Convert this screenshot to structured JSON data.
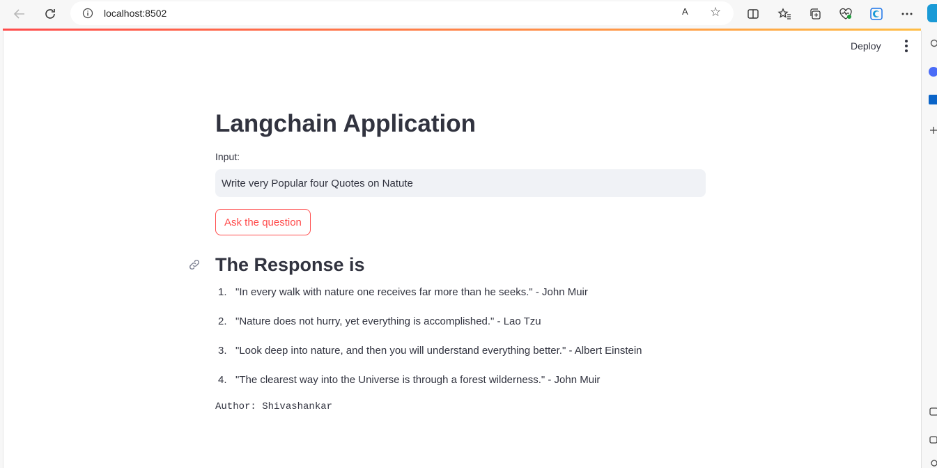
{
  "browser": {
    "url": "localhost:8502",
    "read_aloud": "A",
    "icons": [
      "back-icon",
      "reload-icon",
      "info-icon",
      "read-aloud-icon",
      "star-icon",
      "split-screen-icon",
      "favorites-icon",
      "collections-icon",
      "heartbeat-icon",
      "edge-icon",
      "more-icon"
    ]
  },
  "header": {
    "deploy_label": "Deploy"
  },
  "main": {
    "title": "Langchain Application",
    "input_label": "Input:",
    "input_value": "Write very Popular four Quotes on Natute",
    "button_label": "Ask the question",
    "response_heading": "The Response is",
    "quotes": [
      {
        "num": "1.",
        "text": "\"In every walk with nature one receives far more than he seeks.\" - John Muir"
      },
      {
        "num": "2.",
        "text": "\"Nature does not hurry, yet everything is accomplished.\" - Lao Tzu"
      },
      {
        "num": "3.",
        "text": "\"Look deep into nature, and then you will understand everything better.\" - Albert Einstein"
      },
      {
        "num": "4.",
        "text": "\"The clearest way into the Universe is through a forest wilderness.\" - John Muir"
      }
    ],
    "author": "Author: Shivashankar"
  },
  "colors": {
    "accent": "#ff4b4b",
    "text": "#31333f",
    "input_bg": "#f0f2f6"
  }
}
